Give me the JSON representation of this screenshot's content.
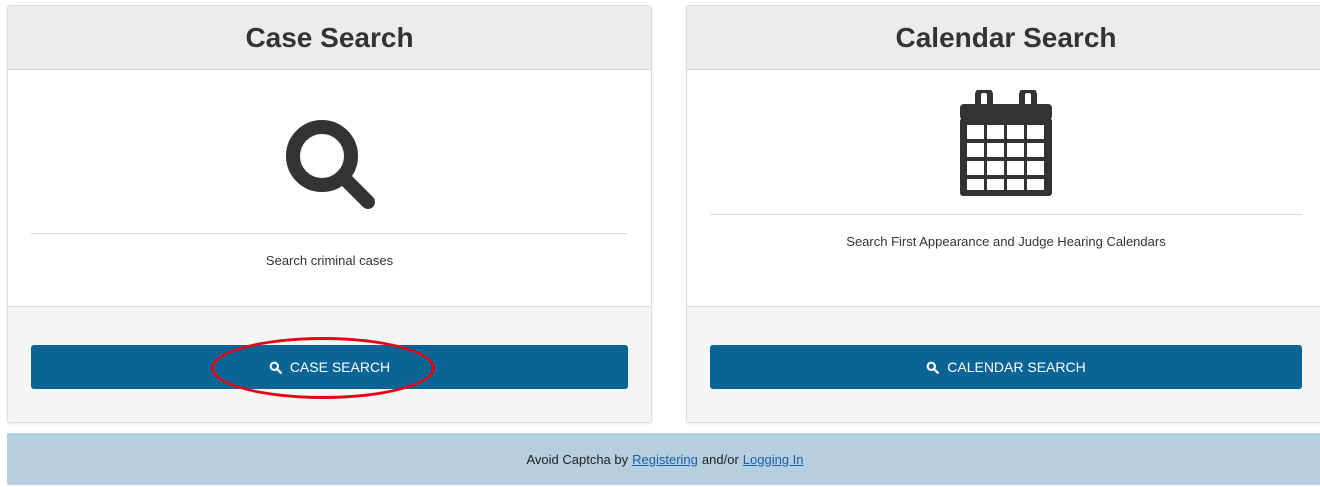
{
  "case_card": {
    "title": "Case Search",
    "icon": "search-icon",
    "description": "Search criminal cases",
    "button_label": "CASE SEARCH",
    "button_icon": "search-icon"
  },
  "calendar_card": {
    "title": "Calendar Search",
    "icon": "calendar-icon",
    "description": "Search First Appearance and Judge Hearing Calendars",
    "button_label": "CALENDAR SEARCH",
    "button_icon": "search-icon"
  },
  "notice": {
    "prefix": "Avoid Captcha by",
    "link_register": "Registering",
    "middle": "and/or",
    "link_login": "Logging In"
  },
  "colors": {
    "button_bg": "#0a6496",
    "header_bg": "#ececec",
    "notice_bg": "#b6cfe0",
    "highlight": "#e30613"
  }
}
